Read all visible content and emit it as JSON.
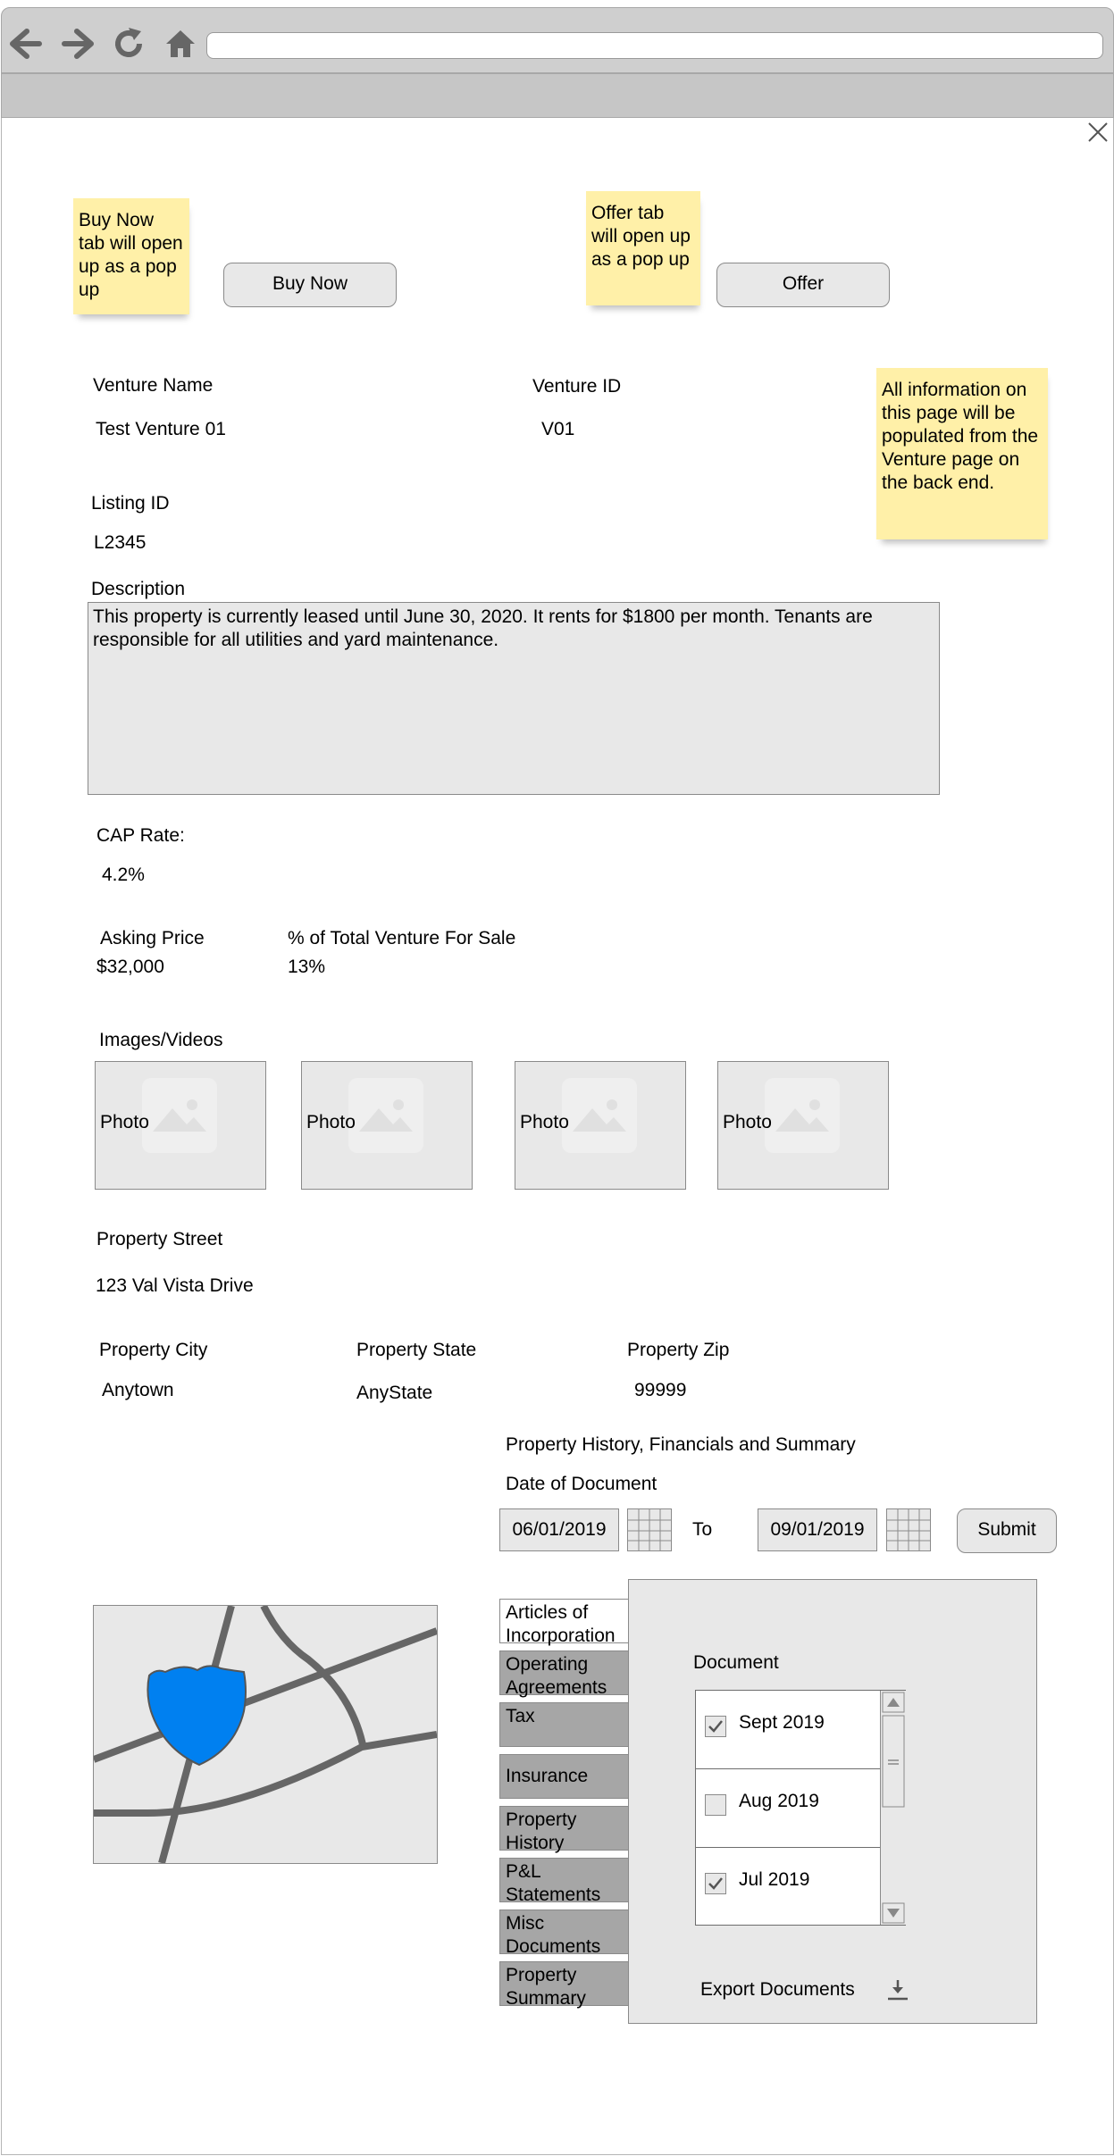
{
  "browser": {
    "address": ""
  },
  "notes": {
    "buy_now": "Buy Now tab will open up as a pop up",
    "offer": "Offer tab will open up as a pop up",
    "info": "All information on this page will be populated from the Venture page on the back end."
  },
  "actions": {
    "buy_now_label": "Buy Now",
    "offer_label": "Offer"
  },
  "venture": {
    "name_label": "Venture Name",
    "name_value": "Test Venture 01",
    "id_label": "Venture ID",
    "id_value": "V01",
    "listing_label": "Listing ID",
    "listing_value": "L2345"
  },
  "description": {
    "label": "Description",
    "text": "This property is currently leased until June 30, 2020. It rents for $1800 per month. Tenants are responsible for all utilities and yard maintenance."
  },
  "financial": {
    "cap_label": "CAP Rate:",
    "cap_value": "4.2%",
    "price_label": "Asking Price",
    "price_value": "$32,000",
    "pct_label": "% of Total Venture For Sale",
    "pct_value": "13%"
  },
  "media": {
    "label": "Images/Videos",
    "photos": [
      "Photo",
      "Photo",
      "Photo",
      "Photo"
    ]
  },
  "address": {
    "street_label": "Property Street",
    "street_value": "123 Val Vista Drive",
    "city_label": "Property City",
    "city_value": "Anytown",
    "state_label": "Property State",
    "state_value": "AnyState",
    "zip_label": "Property Zip",
    "zip_value": "99999"
  },
  "history": {
    "title": "Property History, Financials and Summary",
    "date_label": "Date of Document",
    "from_date": "06/01/2019",
    "to_label": "To",
    "to_date": "09/01/2019",
    "submit_label": "Submit"
  },
  "doc_tabs": [
    "Articles of Incorporation",
    "Operating Agreements",
    "Tax",
    "Insurance",
    "Property History",
    "P&L Statements",
    "Misc Documents",
    "Property Summary"
  ],
  "documents": {
    "header": "Document",
    "rows": [
      {
        "label": "Sept 2019",
        "checked": true
      },
      {
        "label": "Aug 2019",
        "checked": false
      },
      {
        "label": "Jul 2019",
        "checked": true
      }
    ],
    "export_label": "Export Documents"
  },
  "colors": {
    "note": "#fff0a8",
    "shield": "#0080f0",
    "road": "#666666"
  }
}
